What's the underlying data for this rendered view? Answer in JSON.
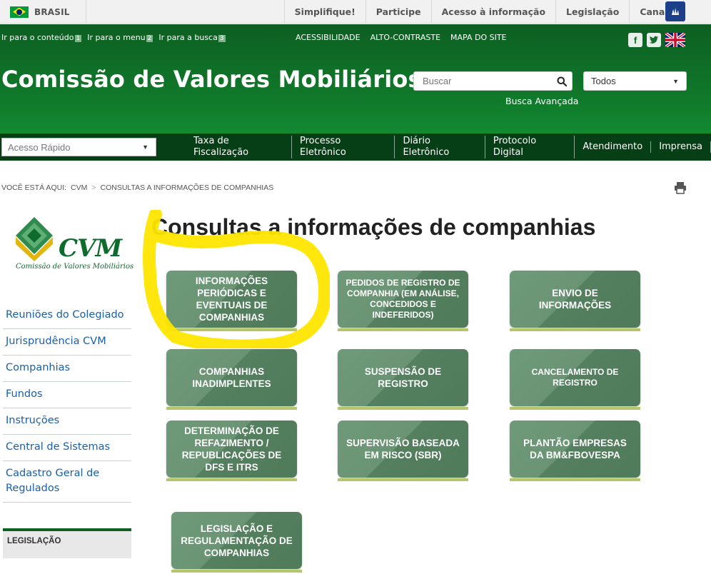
{
  "govbar": {
    "country": "BRASIL",
    "links": [
      "Simplifique!",
      "Participe",
      "Acesso à informação",
      "Legislação",
      "Canais"
    ]
  },
  "header": {
    "skip_links": [
      {
        "label": "Ir para o conteúdo",
        "key": "1"
      },
      {
        "label": "Ir para o menu",
        "key": "2"
      },
      {
        "label": "Ir para a busca",
        "key": "3"
      }
    ],
    "access_links": [
      "ACESSIBILIDADE",
      "ALTO-CONTRASTE",
      "MAPA DO SITE"
    ],
    "title": "Comissão de Valores Mobiliários",
    "search_placeholder": "Buscar",
    "search_scope": "Todos",
    "advanced_search": "Busca Avançada"
  },
  "nav": {
    "quick_access": "Acesso Rápido",
    "links": [
      "Taxa de Fiscalização",
      "Processo Eletrônico",
      "Diário Eletrônico",
      "Protocolo Digital",
      "Atendimento",
      "Imprensa"
    ]
  },
  "breadcrumb": {
    "prefix": "VOCÊ ESTÁ AQUI:",
    "items": [
      "CVM",
      "CONSULTAS A INFORMAÇÕES DE COMPANHIAS"
    ]
  },
  "logo": {
    "name": "CVM",
    "subtitle": "Comissão de Valores Mobiliários"
  },
  "sidebar": {
    "items": [
      "Reuniões do Colegiado",
      "Jurisprudência CVM",
      "Companhias",
      "Fundos",
      "Instruções",
      "Central de Sistemas",
      "Cadastro Geral de Regulados"
    ],
    "box_title": "LEGISLAÇÃO"
  },
  "main": {
    "title": "Consultas a informações de companhias",
    "tiles": [
      "INFORMAÇÕES PERIÓDICAS E EVENTUAIS DE COMPANHIAS",
      "PEDIDOS DE REGISTRO DE COMPANHIA (EM ANÁLISE, CONCEDIDOS E INDEFERIDOS)",
      "ENVIO DE INFORMAÇÕES",
      "COMPANHIAS INADIMPLENTES",
      "SUSPENSÃO DE REGISTRO",
      "CANCELAMENTO DE REGISTRO",
      "DETERMINAÇÃO DE REFAZIMENTO / REPUBLICAÇÕES DE DFS E ITRS",
      "SUPERVISÃO BASEADA EM RISCO (SBR)",
      "PLANTÃO EMPRESAS DA BM&FBOVESPA",
      "LEGISLAÇÃO E REGULAMENTAÇÃO DE COMPANHIAS"
    ]
  },
  "colors": {
    "header_green": "#107a2b",
    "nav_dark": "#063e16",
    "tile_green": "#5f8a6a",
    "tile_underline": "#b6c46a",
    "highlight": "#ffe600",
    "link_blue": "#1a5fa8"
  },
  "icons": [
    "brazil-flag-icon",
    "libras-hand-icon",
    "facebook-icon",
    "twitter-icon",
    "uk-flag-icon",
    "search-icon",
    "print-icon",
    "cvm-logo-icon"
  ]
}
